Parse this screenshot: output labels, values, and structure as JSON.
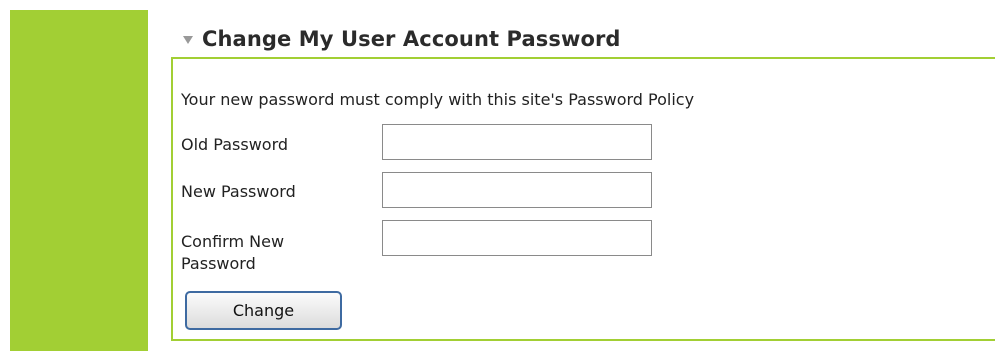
{
  "section": {
    "title": "Change My User Account Password",
    "toggle_icon": "triangle-down-icon"
  },
  "form": {
    "policy_text": "Your new password must comply with this site's Password Policy",
    "old_password_label": "Old Password",
    "old_password_value": "",
    "new_password_label": "New Password",
    "new_password_value": "",
    "confirm_password_label_line1": "Confirm New",
    "confirm_password_label_line2": "Password",
    "confirm_password_value": "",
    "submit_label": "Change"
  },
  "colors": {
    "accent_green": "#a2cf34",
    "button_border": "#3e6aa1"
  }
}
